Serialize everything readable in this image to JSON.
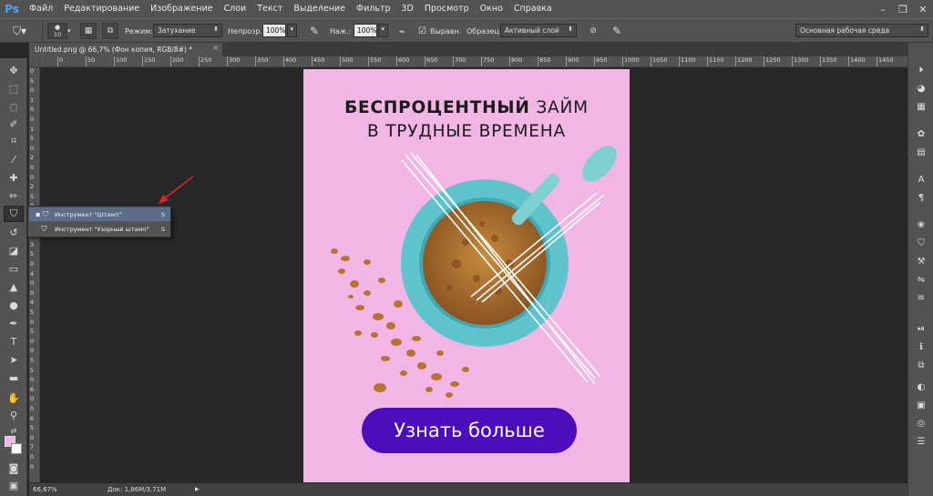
{
  "app": {
    "logo": "Ps"
  },
  "menu": {
    "items": [
      "Файл",
      "Редактирование",
      "Изображение",
      "Слои",
      "Текст",
      "Выделение",
      "Фильтр",
      "3D",
      "Просмотр",
      "Окно",
      "Справка"
    ]
  },
  "window_controls": {
    "minimize": "–",
    "restore": "❐",
    "close": "✕"
  },
  "options": {
    "brush_size": "10",
    "mode_label": "Режим:",
    "mode_value": "Затухание",
    "opacity_label": "Непрозр.:",
    "opacity_value": "100%",
    "flow_label": "Наж.:",
    "flow_value": "100%",
    "aligned_label": "Выравн.",
    "sample_label": "Образец:",
    "sample_value": "Активный слой",
    "workspace": "Основная рабочая среда"
  },
  "document": {
    "tab_title": "Untitled.png @ 66,7% (Фон копия, RGB/8#) *",
    "close": "×"
  },
  "ruler": {
    "h_ticks": [
      "50",
      "0",
      "50",
      "100",
      "150",
      "200",
      "250",
      "300",
      "350",
      "400",
      "450",
      "500",
      "550",
      "600",
      "650",
      "700",
      "750",
      "800",
      "850",
      "900",
      "950",
      "1000",
      "1050",
      "1100",
      "1150",
      "1200",
      "1250",
      "1300",
      "1350",
      "1400",
      "1450"
    ],
    "v_ticks": [
      "0",
      "5",
      "0",
      "1",
      "0",
      "0",
      "1",
      "5",
      "0",
      "2",
      "0",
      "0",
      "2",
      "5",
      "0",
      "3",
      "0",
      "0",
      "3",
      "5",
      "0",
      "4",
      "0",
      "0",
      "4",
      "5",
      "0",
      "5",
      "0",
      "0",
      "5",
      "5",
      "0",
      "6",
      "0",
      "0",
      "6",
      "5",
      "0",
      "7",
      "0",
      "0"
    ]
  },
  "tool_popup": {
    "items": [
      {
        "label": "Инструмент \"Штамп\"",
        "key": "S",
        "selected": true
      },
      {
        "label": "Инструмент \"Узорный штамп\"",
        "key": "S",
        "selected": false
      }
    ]
  },
  "poster": {
    "headline_bold": "БЕСПРОЦЕНТНЫЙ",
    "headline_rest": " ЗАЙМ",
    "headline_line2": "В ТРУДНЫЕ ВРЕМЕНА",
    "cta": "Узнать больше",
    "colors": {
      "background": "#f1b6e3",
      "button": "#4c0dbd",
      "bowl": "#5ec3cc"
    }
  },
  "status": {
    "zoom": "66,67%",
    "doc_size": "Док: 1,86M/3,71M",
    "arrow": "▶"
  }
}
